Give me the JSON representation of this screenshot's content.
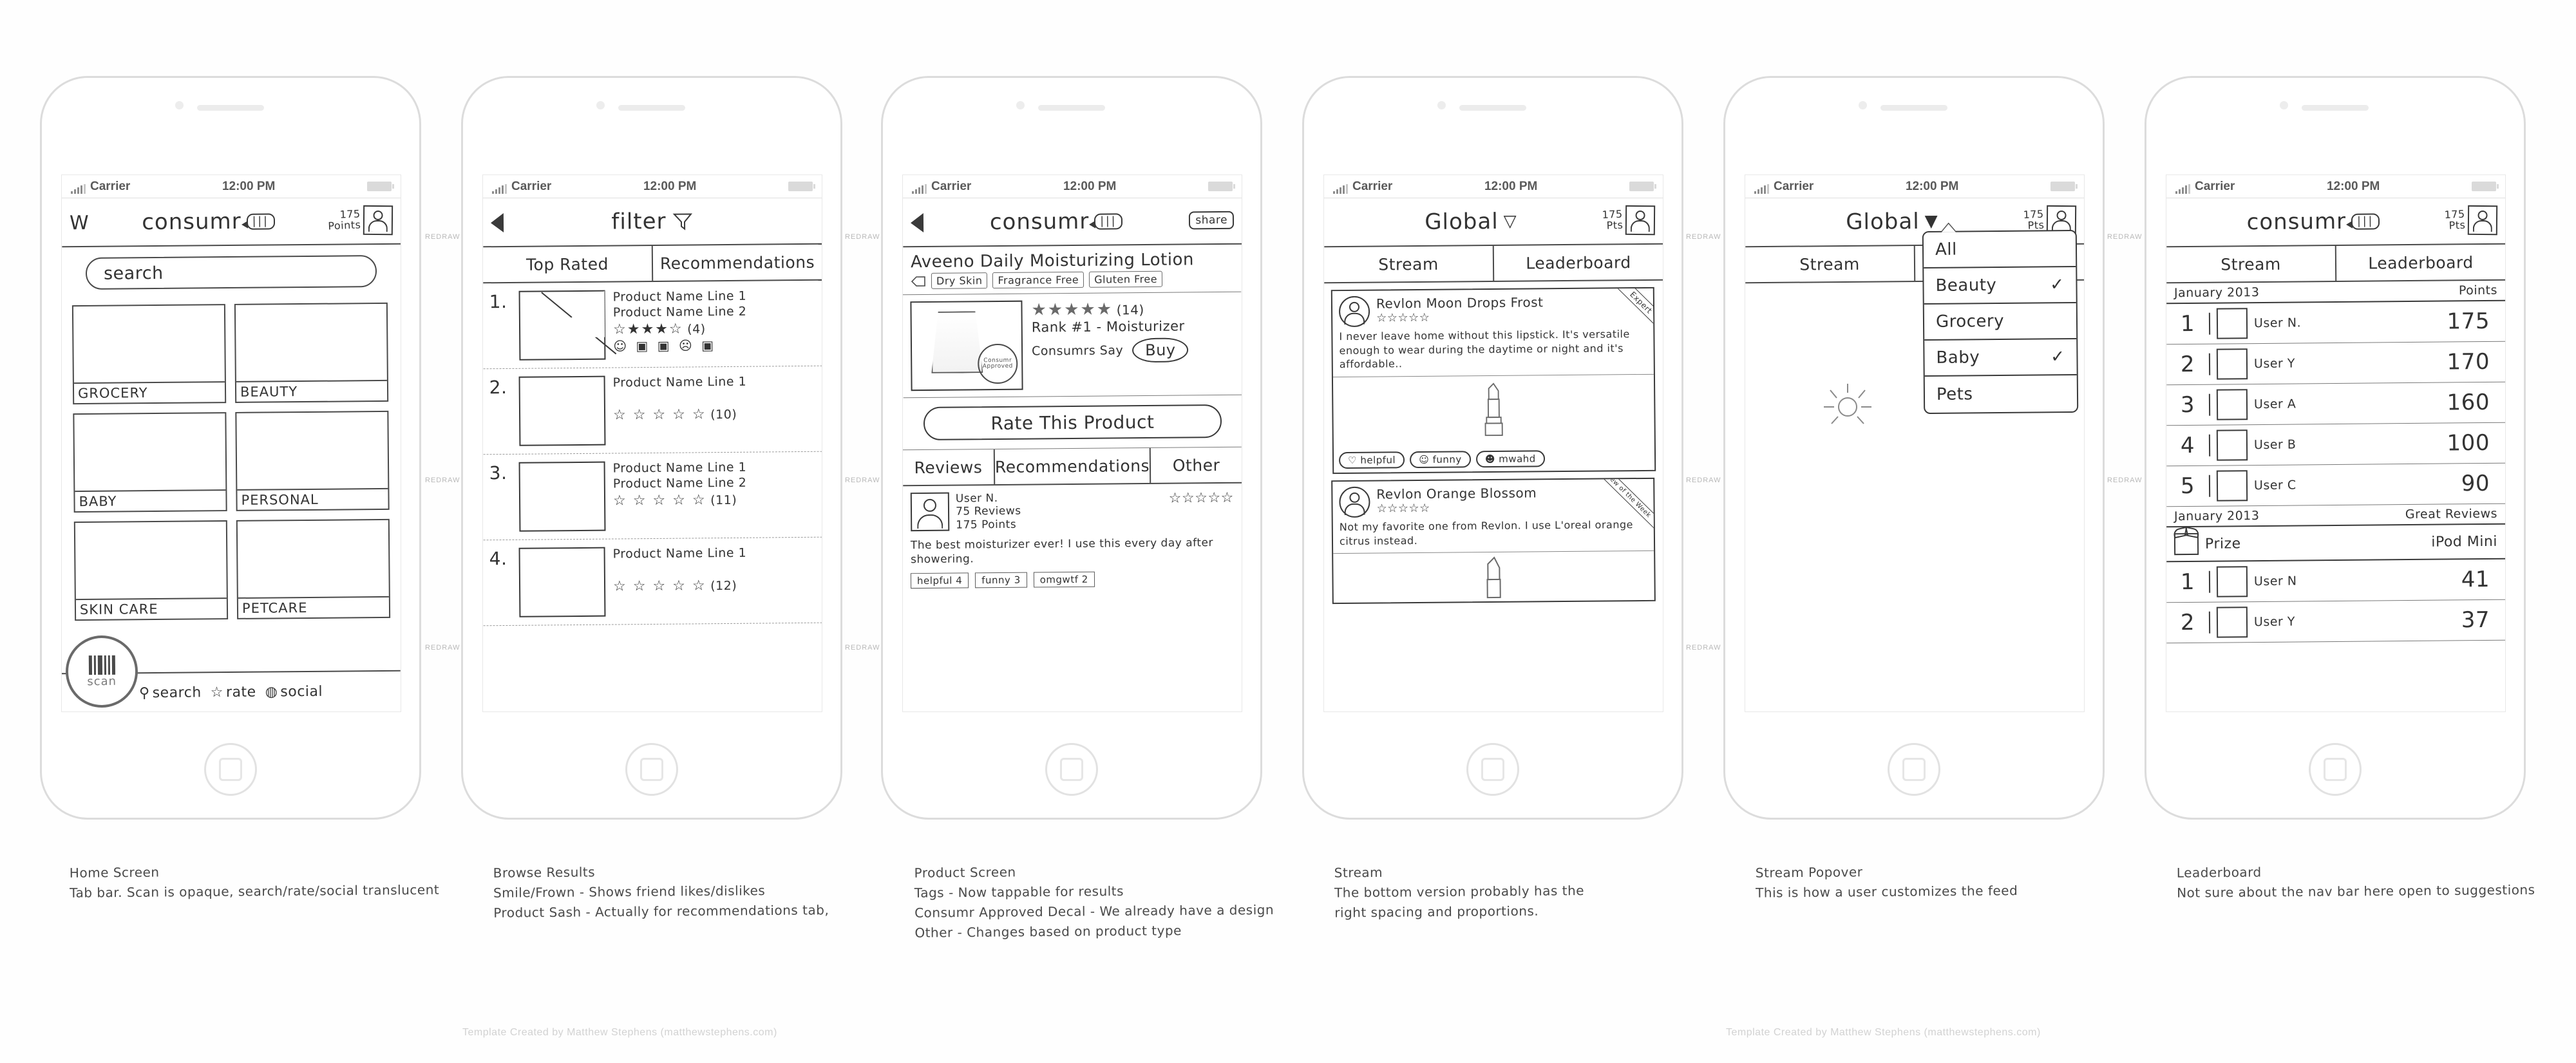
{
  "sheet": {
    "footer_left": "Template Created by Matthew Stephens (matthewstephens.com)",
    "footer_right": "Template Created by Matthew Stephens (matthewstephens.com)",
    "side_label": "REDRAW"
  },
  "status_bar": {
    "carrier": "Carrier",
    "time": "12:00 PM"
  },
  "screens": [
    {
      "caption_title": "Home Screen",
      "caption_body": "Tab bar. Scan is opaque, search/rate/social translucent",
      "nav": {
        "logo": "W",
        "title": "consumr",
        "bubble": "|||",
        "points": "175",
        "points_label": "Points"
      },
      "search_placeholder": "search",
      "categories": [
        "GROCERY",
        "BEAUTY",
        "BABY",
        "PERSONAL",
        "SKIN CARE",
        "PETCARE"
      ],
      "scan_label": "scan",
      "tabs": [
        "search",
        "rate",
        "social"
      ]
    },
    {
      "caption_title": "Browse Results",
      "caption_body_1": "Smile/Frown - Shows friend likes/dislikes",
      "caption_body_2": "Product Sash - Actually for recommendations tab,",
      "nav_title": "filter",
      "tabs": [
        "Top Rated",
        "Recommendations"
      ],
      "results": [
        {
          "num": "1.",
          "line1": "Product Name Line 1",
          "line2": "Product Name Line 2",
          "stars": "☆★★★☆",
          "count": "(4)",
          "faces": "☺ ▣ ▣   ☹ ▣"
        },
        {
          "num": "2.",
          "line1": "Product Name Line 1",
          "line2": "",
          "stars": "☆ ☆ ☆ ☆ ☆",
          "count": "(10)",
          "faces": ""
        },
        {
          "num": "3.",
          "line1": "Product Name Line 1",
          "line2": "Product Name Line 2",
          "stars": "☆ ☆ ☆ ☆ ☆",
          "count": "(11)",
          "faces": ""
        },
        {
          "num": "4.",
          "line1": "Product Name Line 1",
          "line2": "",
          "stars": "☆ ☆ ☆ ☆ ☆",
          "count": "(12)",
          "faces": ""
        }
      ]
    },
    {
      "caption_title": "Product Screen",
      "caption_body_1": "Tags - Now tappable for results",
      "caption_body_2": "Consumr Approved Decal - We already have a design",
      "caption_body_3": "Other - Changes based on product type",
      "nav": {
        "title": "consumr",
        "bubble": "|||",
        "share": "share"
      },
      "product_name": "Aveeno Daily Moisturizing Lotion",
      "tags": [
        "Dry Skin",
        "Fragrance Free",
        "Gluten Free"
      ],
      "stars": "★★★★★",
      "rating_count": "(14)",
      "rank": "Rank #1 - Moisturizer",
      "consumrs_say": "Consumrs Say",
      "buy_label": "Buy",
      "seal": "Consumr Approved",
      "rate_button": "Rate This Product",
      "tabs": [
        "Reviews",
        "Recommendations",
        "Other"
      ],
      "review": {
        "user": "User N.",
        "reviews_count": "75 Reviews",
        "points": "175 Points",
        "stars": "☆☆☆☆☆",
        "text": "The best moisturizer ever! I use this every day after showering.",
        "badges": [
          "helpful  4",
          "funny  3",
          "omgwtf  2"
        ]
      }
    },
    {
      "caption_title": "Stream",
      "caption_body_1": "The bottom version probably has the",
      "caption_body_2": "right  spacing and proportions.",
      "nav": {
        "title": "Global",
        "chevron": "▽",
        "points": "175",
        "points_label": "Pts"
      },
      "tabs": [
        "Stream",
        "Leaderboard"
      ],
      "cards": [
        {
          "title": "Revlon Moon Drops Frost",
          "stars": "☆☆☆☆☆",
          "ribbon": "Expert",
          "text": "I never leave home without this lipstick. It's versatile enough to wear during the daytime or night and it's affordable..",
          "actions": [
            "♡ helpful",
            "☺ funny",
            "☻ mwahd"
          ]
        },
        {
          "title": "Revlon Orange Blossom",
          "stars": "☆☆☆☆☆",
          "ribbon": "Review of the Week",
          "text": "Not my favorite one from Revlon. I use L'oreal orange citrus instead.",
          "actions": []
        }
      ]
    },
    {
      "caption_title": "Stream Popover",
      "caption_body": "This is how a user customizes the feed",
      "nav": {
        "title": "Global",
        "chevron": "▼",
        "points": "175",
        "points_label": "Pts"
      },
      "tabs": [
        "Stream"
      ],
      "popover_items": [
        {
          "label": "All",
          "checked": ""
        },
        {
          "label": "Beauty",
          "checked": "✓"
        },
        {
          "label": "Grocery",
          "checked": ""
        },
        {
          "label": "Baby",
          "checked": "✓"
        },
        {
          "label": "Pets",
          "checked": ""
        }
      ]
    },
    {
      "caption_title": "Leaderboard",
      "caption_body": "Not sure about the nav bar here open to suggestions",
      "nav": {
        "title": "consumr",
        "bubble": "|||",
        "points": "175",
        "points_label": "Pts"
      },
      "tabs": [
        "Stream",
        "Leaderboard"
      ],
      "section_1": {
        "period": "January 2013",
        "metric": "Points",
        "rows": [
          {
            "rank": "1",
            "name": "User N.",
            "value": "175"
          },
          {
            "rank": "2",
            "name": "User Y",
            "value": "170"
          },
          {
            "rank": "3",
            "name": "User A",
            "value": "160"
          },
          {
            "rank": "4",
            "name": "User B",
            "value": "100"
          },
          {
            "rank": "5",
            "name": "User C",
            "value": "90"
          }
        ]
      },
      "section_2": {
        "period": "January 2013",
        "metric": "Great Reviews",
        "prize_label": "Prize",
        "prize_value": "iPod Mini",
        "rows": [
          {
            "rank": "1",
            "name": "User N",
            "value": "41"
          },
          {
            "rank": "2",
            "name": "User Y",
            "value": "37"
          }
        ]
      }
    }
  ]
}
